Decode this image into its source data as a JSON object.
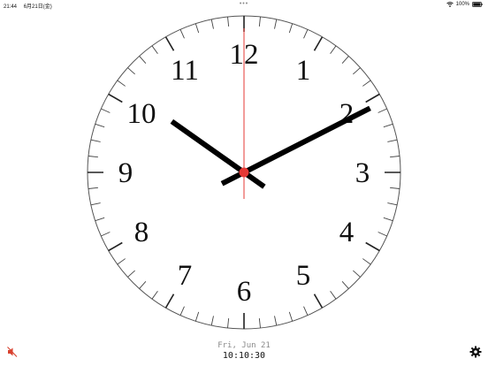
{
  "status_bar": {
    "time": "21:44",
    "date": "6月21日(金)",
    "battery": "100%",
    "multitasking_dots": "•••"
  },
  "clock": {
    "numerals": [
      "12",
      "1",
      "2",
      "3",
      "4",
      "5",
      "6",
      "7",
      "8",
      "9",
      "10",
      "11"
    ],
    "hours": 10,
    "minutes": 10,
    "seconds": 30,
    "second_hand_color": "#e53935",
    "hand_color": "#000000"
  },
  "footer": {
    "date": "Fri, Jun 21",
    "time": "10:10:30"
  },
  "icons": {
    "mute": "speaker-muted-icon",
    "settings": "gear-icon"
  },
  "colors": {
    "accent": "#e53935",
    "settings": "#111111"
  }
}
